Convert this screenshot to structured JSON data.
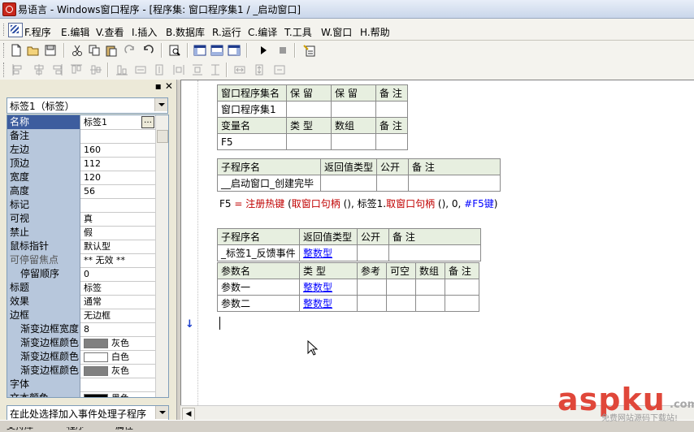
{
  "window": {
    "title": "易语言 - Windows窗口程序 - [程序集: 窗口程序集1 / _启动窗口]"
  },
  "menu": {
    "items": [
      "F.程序",
      "E.编辑",
      "V.查看",
      "I.插入",
      "B.数据库",
      "R.运行",
      "C.编译",
      "T.工具",
      "W.窗口",
      "H.帮助"
    ]
  },
  "toolbar1": {
    "icons": [
      "new-file-icon",
      "open-folder-icon",
      "save-icon",
      "cut-icon",
      "copy-icon",
      "paste-icon",
      "redo-icon",
      "undo-icon",
      "find-icon",
      "layout1-icon",
      "layout2-icon",
      "layout3-icon",
      "run-icon",
      "stop-icon",
      "debug-icon"
    ]
  },
  "toolbar2": {
    "icons": [
      "align-left-icon",
      "align-center-icon",
      "align-right-icon",
      "align-top-icon",
      "align-middle-icon",
      "align-bottom-icon",
      "same-width-icon",
      "same-height-icon",
      "h-space-icon",
      "v-space-icon",
      "center-icon"
    ]
  },
  "leftpanel": {
    "header_close": "▪ ✕",
    "combo_value": "标签1（标签）",
    "properties": [
      {
        "name": "名称",
        "value": "标签1",
        "ellipsis": "…"
      },
      {
        "name": "备注",
        "value": ""
      },
      {
        "name": "左边",
        "value": "160"
      },
      {
        "name": "顶边",
        "value": "112"
      },
      {
        "name": "宽度",
        "value": "120"
      },
      {
        "name": "高度",
        "value": "56"
      },
      {
        "name": "标记",
        "value": ""
      },
      {
        "name": "可视",
        "value": "真"
      },
      {
        "name": "禁止",
        "value": "假"
      },
      {
        "name": "鼠标指针",
        "value": "默认型"
      },
      {
        "name": "可停留焦点",
        "value": "** 无效 **"
      },
      {
        "name": "停留顺序",
        "value": "0"
      },
      {
        "name": "标题",
        "value": "标签"
      },
      {
        "name": "效果",
        "value": "通常"
      },
      {
        "name": "边框",
        "value": "无边框"
      },
      {
        "name": "渐变边框宽度",
        "value": "8"
      },
      {
        "name": "渐变边框颜色",
        "value": "灰色",
        "swatch": "#808080"
      },
      {
        "name": "渐变边框颜色",
        "value": "白色",
        "swatch": "#ffffff"
      },
      {
        "name": "渐变边框颜色",
        "value": "灰色",
        "swatch": "#808080"
      },
      {
        "name": "字体",
        "value": ""
      },
      {
        "name": "文本颜色",
        "value": "黑色",
        "swatch": "#000000"
      }
    ],
    "event_combo": "在此处选择加入事件处理子程序",
    "tabs": [
      "支持库",
      "程序",
      "属性"
    ]
  },
  "editor": {
    "table1": {
      "rows": [
        [
          "窗口程序集名",
          "保 留",
          "保 留",
          "备 注"
        ],
        [
          "窗口程序集1",
          "",
          "",
          ""
        ],
        [
          "变量名",
          "类 型",
          "数组",
          "备 注"
        ],
        [
          "F5",
          "",
          "",
          ""
        ]
      ]
    },
    "table2": {
      "rows": [
        [
          "子程序名",
          "返回值类型",
          "公开",
          "备 注"
        ],
        [
          "__启动窗口_创建完毕",
          "",
          "",
          ""
        ]
      ]
    },
    "code": {
      "var": "F5",
      "op": " = ",
      "fn": "注册热键",
      "p1": " (",
      "arg1": "取窗口句柄",
      "p2": " ()",
      "c1": ", ",
      "arg2": "标签1",
      "dot": ".",
      "arg3": "取窗口句柄",
      "p3": " ()",
      "c2": ", 0, ",
      "arg4": "#F5键",
      "p4": ")"
    },
    "table3": {
      "rows": [
        [
          "子程序名",
          "返回值类型",
          "公开",
          "备 注"
        ],
        [
          "_标签1_反馈事件",
          "整数型",
          "",
          ""
        ]
      ]
    },
    "table4": {
      "rows": [
        [
          "参数名",
          "类 型",
          "参考",
          "可空",
          "数组",
          "备 注"
        ],
        [
          "参数一",
          "整数型",
          "",
          "",
          "",
          ""
        ],
        [
          "参数二",
          "整数型",
          "",
          "",
          "",
          ""
        ]
      ]
    },
    "gutter_mark": "↓"
  },
  "watermark": {
    "text_asp": "asp",
    "text_ku": "ku",
    "text_com": ".com",
    "sub": "免费网站源码下载站!"
  }
}
